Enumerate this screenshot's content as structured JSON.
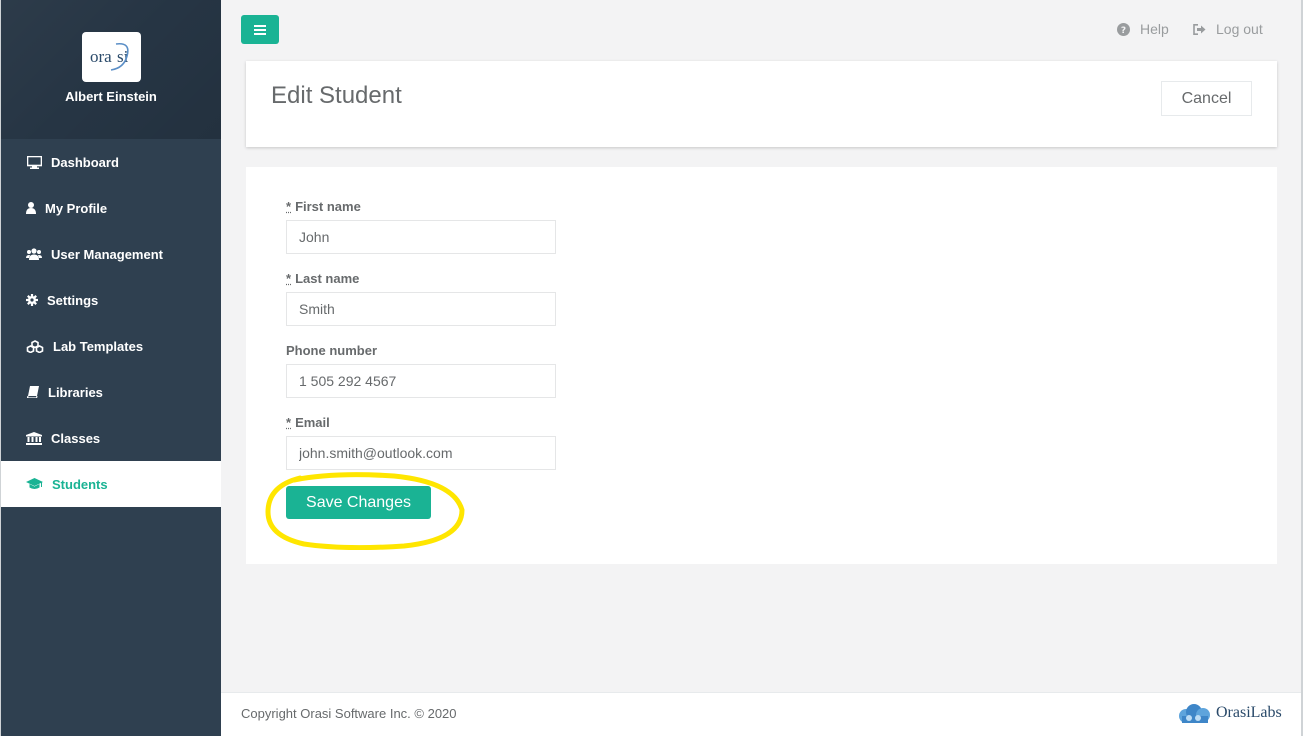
{
  "profile": {
    "logo_text": "orasi",
    "name": "Albert Einstein"
  },
  "sidebar": {
    "items": [
      {
        "label": "Dashboard",
        "icon": "desktop-icon",
        "active": false
      },
      {
        "label": "My Profile",
        "icon": "user-icon",
        "active": false
      },
      {
        "label": "User Management",
        "icon": "users-icon",
        "active": false
      },
      {
        "label": "Settings",
        "icon": "gear-icon",
        "active": false
      },
      {
        "label": "Lab Templates",
        "icon": "cubes-icon",
        "active": false
      },
      {
        "label": "Libraries",
        "icon": "book-icon",
        "active": false
      },
      {
        "label": "Classes",
        "icon": "institution-icon",
        "active": false
      },
      {
        "label": "Students",
        "icon": "graduation-cap-icon",
        "active": true
      }
    ]
  },
  "topbar": {
    "help_label": "Help",
    "logout_label": "Log out"
  },
  "header": {
    "title": "Edit Student",
    "cancel_label": "Cancel"
  },
  "form": {
    "required_marker": "*",
    "first_name": {
      "label": "First name",
      "value": "John",
      "required": true
    },
    "last_name": {
      "label": "Last name",
      "value": "Smith",
      "required": true
    },
    "phone": {
      "label": "Phone number",
      "value": "1 505 292 4567",
      "required": false
    },
    "email": {
      "label": "Email",
      "value": "john.smith@outlook.com",
      "required": true
    },
    "save_label": "Save Changes"
  },
  "annotation": {
    "color": "#ffe600",
    "target": "save-changes-button"
  },
  "footer": {
    "copyright": "Copyright Orasi Software Inc. © 2020",
    "brand": "OrasiLabs"
  },
  "colors": {
    "accent": "#1ab394",
    "sidebar": "#2f4050"
  }
}
